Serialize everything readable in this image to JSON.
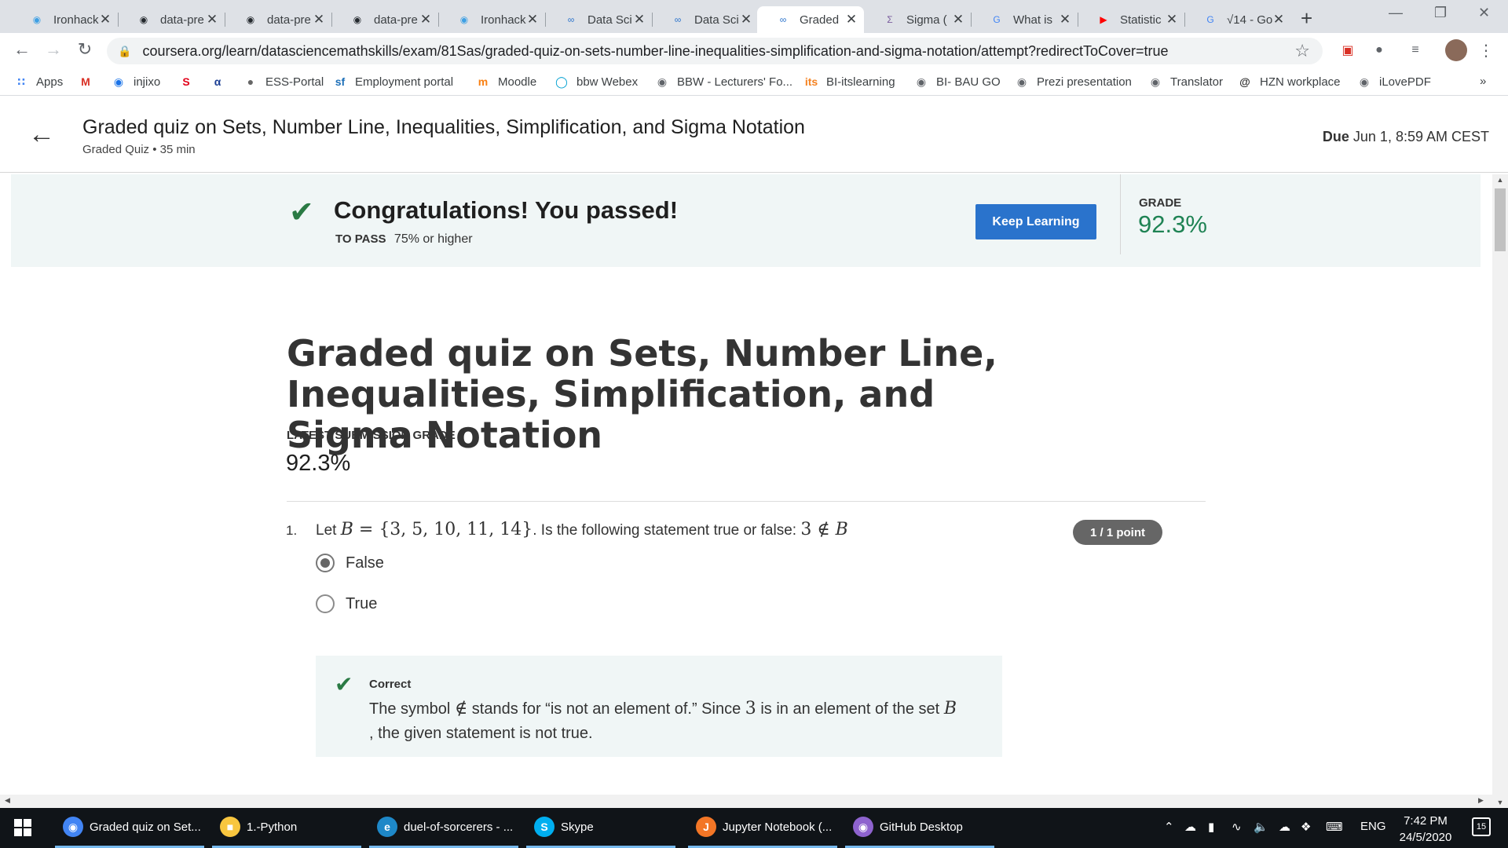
{
  "browser": {
    "tabs": [
      {
        "title": "Ironhack",
        "icon": "ironhack-icon",
        "color": "#3ea0e4"
      },
      {
        "title": "data-pre",
        "icon": "github-icon",
        "color": "#24292e"
      },
      {
        "title": "data-pre",
        "icon": "github-icon",
        "color": "#24292e"
      },
      {
        "title": "data-pre",
        "icon": "github-icon",
        "color": "#24292e"
      },
      {
        "title": "Ironhack",
        "icon": "ironhack-icon",
        "color": "#3ea0e4"
      },
      {
        "title": "Data Sci",
        "icon": "coursera-icon",
        "color": "#2a73cc"
      },
      {
        "title": "Data Sci",
        "icon": "coursera-icon",
        "color": "#2a73cc"
      },
      {
        "title": "Graded",
        "icon": "coursera-icon",
        "color": "#2a73cc",
        "active": true
      },
      {
        "title": "Sigma (",
        "icon": "sigma-icon",
        "color": "#7a5c9e"
      },
      {
        "title": "What is",
        "icon": "google-icon",
        "color": "#4285f4"
      },
      {
        "title": "Statistic",
        "icon": "youtube-icon",
        "color": "#ff0000"
      },
      {
        "title": "√14 - Go",
        "icon": "google-icon",
        "color": "#4285f4"
      }
    ],
    "url": "coursera.org/learn/datasciencemathskills/exam/81Sas/graded-quiz-on-sets-number-line-inequalities-simplification-and-sigma-notation/attempt?redirectToCover=true",
    "bookmarks": [
      {
        "label": "Apps",
        "icon": "apps-grid-icon",
        "color": "#4285f4"
      },
      {
        "label": "",
        "icon": "gmail-icon",
        "color": "#d93025"
      },
      {
        "label": "injixo",
        "icon": "injixo-icon",
        "color": "#1a73e8"
      },
      {
        "label": "",
        "icon": "sparkasse-icon",
        "color": "#e2001a"
      },
      {
        "label": "",
        "icon": "alpha-icon",
        "color": "#1c3f94"
      },
      {
        "label": "ESS-Portal",
        "icon": "apple-icon",
        "color": "#666666"
      },
      {
        "label": "Employment portal",
        "icon": "sf-icon",
        "color": "#1d6fb8"
      },
      {
        "label": "Moodle",
        "icon": "moodle-icon",
        "color": "#f98012"
      },
      {
        "label": "bbw Webex",
        "icon": "webex-icon",
        "color": "#00a0d1"
      },
      {
        "label": "BBW - Lecturers' Fo...",
        "icon": "globe-icon",
        "color": "#5f6368"
      },
      {
        "label": "BI-itslearning",
        "icon": "itslearning-icon",
        "color": "#f58220"
      },
      {
        "label": "BI- BAU GO",
        "icon": "globe-icon",
        "color": "#5f6368"
      },
      {
        "label": "Prezi presentation",
        "icon": "globe-icon",
        "color": "#5f6368"
      },
      {
        "label": "Translator",
        "icon": "globe-icon",
        "color": "#5f6368"
      },
      {
        "label": "HZN workplace",
        "icon": "hzn-icon",
        "color": "#333333"
      },
      {
        "label": "iLovePDF",
        "icon": "globe-icon",
        "color": "#5f6368"
      }
    ],
    "bookmarks_overflow": "»"
  },
  "header": {
    "title": "Graded quiz on Sets, Number Line, Inequalities, Simplification, and Sigma Notation",
    "subtitle": "Graded Quiz • 35 min",
    "due_label": "Due",
    "due_value": "Jun 1, 8:59 AM CEST"
  },
  "banner": {
    "message": "Congratulations! You passed!",
    "to_pass_label": "TO PASS",
    "to_pass_value": "75% or higher",
    "button": "Keep Learning",
    "grade_label": "GRADE",
    "grade_value": "92.3%",
    "accent_color": "#1f8354",
    "button_color": "#2a73cc"
  },
  "quiz": {
    "title": "Graded quiz on Sets, Number Line, Inequalities, Simplification, and Sigma Notation",
    "latest_label": "LATEST SUBMISSION GRADE",
    "latest_value": "92.3%",
    "question": {
      "number": "1.",
      "prefix": "Let",
      "set_var": "B",
      "equals": "=",
      "set_values": "{3, 5, 10, 11, 14}",
      "middle": ". Is the following statement true or false:",
      "statement_lhs": "3",
      "statement_op": "∉",
      "statement_rhs": "B",
      "points": "1 / 1 point",
      "options": [
        {
          "label": "False",
          "selected": true
        },
        {
          "label": "True",
          "selected": false
        }
      ],
      "feedback": {
        "status": "Correct",
        "text_1": "The symbol",
        "symbol": "∉",
        "text_2": "stands for “is not an element of.” Since",
        "num": "3",
        "text_3": "is in an element of the set",
        "var": "B",
        "text_4": ", the given statement is not true."
      }
    }
  },
  "taskbar": {
    "items": [
      {
        "label": "Graded quiz on Set...",
        "icon": "chrome-icon",
        "color": "#4285f4"
      },
      {
        "label": "1.-Python",
        "icon": "folder-icon",
        "color": "#f8c63f"
      },
      {
        "label": "duel-of-sorcerers - ...",
        "icon": "edge-icon",
        "color": "#1e88c8"
      },
      {
        "label": "Skype",
        "icon": "skype-icon",
        "color": "#00aff0"
      },
      {
        "label": "Jupyter Notebook (...",
        "icon": "jupyter-icon",
        "color": "#f37626"
      },
      {
        "label": "GitHub Desktop",
        "icon": "github-desktop-icon",
        "color": "#8e63ce"
      }
    ],
    "language": "ENG",
    "time": "7:42 PM",
    "date": "24/5/2020",
    "notifications": "15"
  }
}
